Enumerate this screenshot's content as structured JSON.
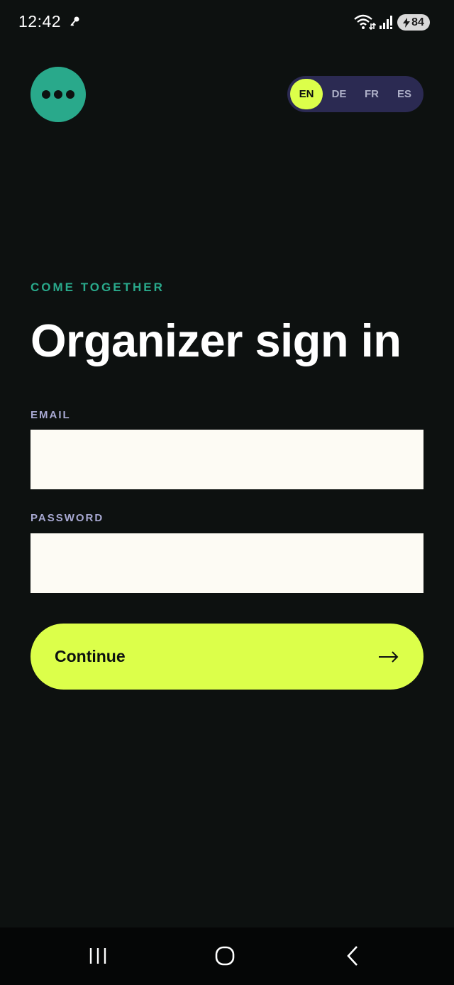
{
  "status_bar": {
    "time": "12:42",
    "battery": "84",
    "icons": [
      "key-icon",
      "wifi-icon",
      "signal-icon",
      "battery-charging-icon"
    ]
  },
  "header": {
    "menu_icon": "more-dots-icon",
    "languages": [
      {
        "code": "EN",
        "active": true
      },
      {
        "code": "DE",
        "active": false
      },
      {
        "code": "FR",
        "active": false
      },
      {
        "code": "ES",
        "active": false
      }
    ]
  },
  "main": {
    "eyebrow": "COME TOGETHER",
    "title": "Organizer sign in",
    "email_label": "EMAIL",
    "email_value": "",
    "password_label": "PASSWORD",
    "password_value": "",
    "continue_label": "Continue",
    "continue_icon": "arrow-right-icon"
  },
  "nav_bar": {
    "icons": [
      "recents-icon",
      "home-icon",
      "back-icon"
    ]
  },
  "colors": {
    "background": "#0d1110",
    "accent_green": "#29a98b",
    "accent_lime": "#dcff4a",
    "lang_pill": "#2b2a52",
    "label_lavender": "#a8a9d2",
    "field_bg": "#fdfbf4"
  }
}
